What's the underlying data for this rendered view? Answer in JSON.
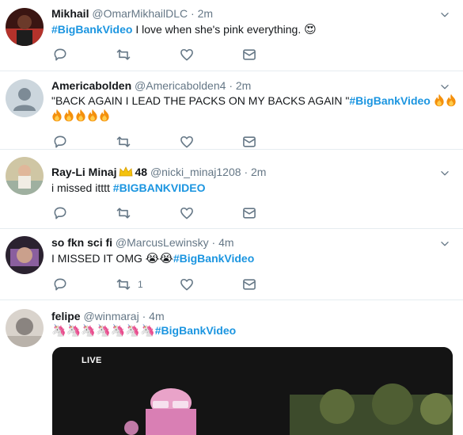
{
  "tweets": [
    {
      "name": "Mikhail",
      "handle": "@OmarMikhailDLC",
      "time": "2m",
      "hashtag": "#BigBankVideo",
      "text": " I love when she's pink everything. ",
      "emoji": "😍"
    },
    {
      "name": "Americabolden",
      "handle": "@Americabolden4",
      "time": "2m",
      "text": "\"BACK AGAIN I LEAD THE PACKS ON MY BACKS AGAIN \"",
      "hashtag": "#BigBankVideo",
      "emoji": "🔥"
    },
    {
      "name": "Ray-Li Minaj",
      "name_suffix": "48",
      "handle": "@nicki_minaj1208",
      "time": "2m",
      "text": "i missed itttt ",
      "hashtag": "#BIGBANKVIDEO",
      "emoji": "👑"
    },
    {
      "name": "so fkn sci fi",
      "handle": "@MarcusLewinsky",
      "time": "4m",
      "text": "I MISSED IT OMG ",
      "emoji": "😭😭",
      "hashtag": "#BigBankVideo",
      "retweets": "1"
    },
    {
      "name": "felipe",
      "handle": "@winmaraj",
      "time": "4m",
      "emoji": "🦄🦄🦄🦄🦄🦄🦄",
      "hashtag": "#BigBankVideo",
      "media_label": "LIVE"
    }
  ],
  "separator": "·",
  "colors": {
    "link": "#1b95e0",
    "secondary": "#657786",
    "border": "#e6ecf0"
  },
  "icons": [
    "reply-icon",
    "retweet-icon",
    "like-icon",
    "message-icon",
    "chevron-down-icon"
  ]
}
